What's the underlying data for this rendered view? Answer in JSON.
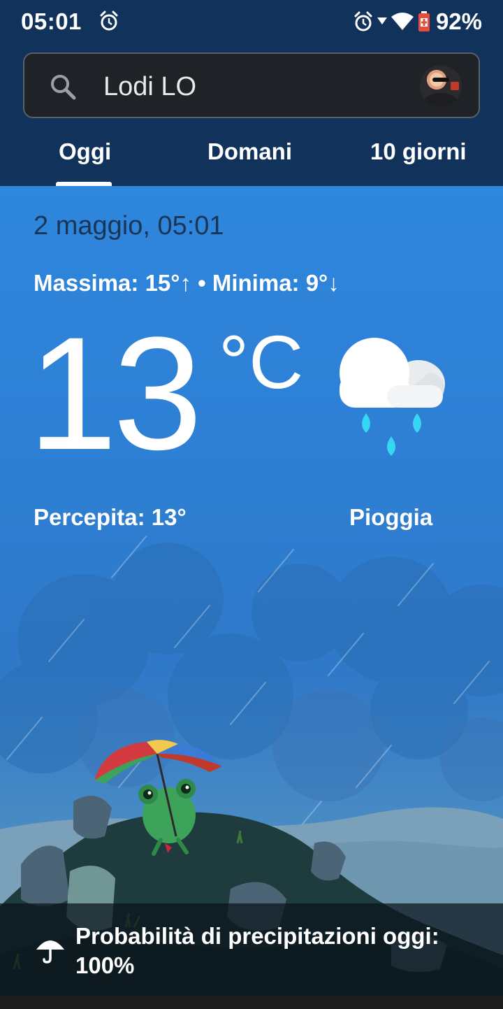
{
  "status_bar": {
    "time": "05:01",
    "battery": "92%",
    "icons": [
      "alarm-icon",
      "alarm-icon",
      "signal-icon",
      "wifi-icon",
      "battery-icon"
    ]
  },
  "search": {
    "value": "Lodi LO",
    "icon": "search-icon"
  },
  "tabs": [
    {
      "label": "Oggi",
      "selected": true
    },
    {
      "label": "Domani",
      "selected": false
    },
    {
      "label": "10 giorni",
      "selected": false
    }
  ],
  "weather": {
    "date_time": "2 maggio, 05:01",
    "max_min": "Massima: 15°↑ • Minima: 9°↓",
    "temperature": "13",
    "unit": "°C",
    "feels_like": "Percepita: 13°",
    "condition": "Pioggia",
    "condition_icon": "rain-cloud-icon"
  },
  "precipitation": {
    "text": "Probabilità di precipitazioni oggi: 100%",
    "icon": "umbrella-icon"
  },
  "colors": {
    "header_bg": "#10325b",
    "sky_blue": "#2e86dd",
    "date_text": "#1b3557",
    "rain_drop": "#35d7f2"
  }
}
